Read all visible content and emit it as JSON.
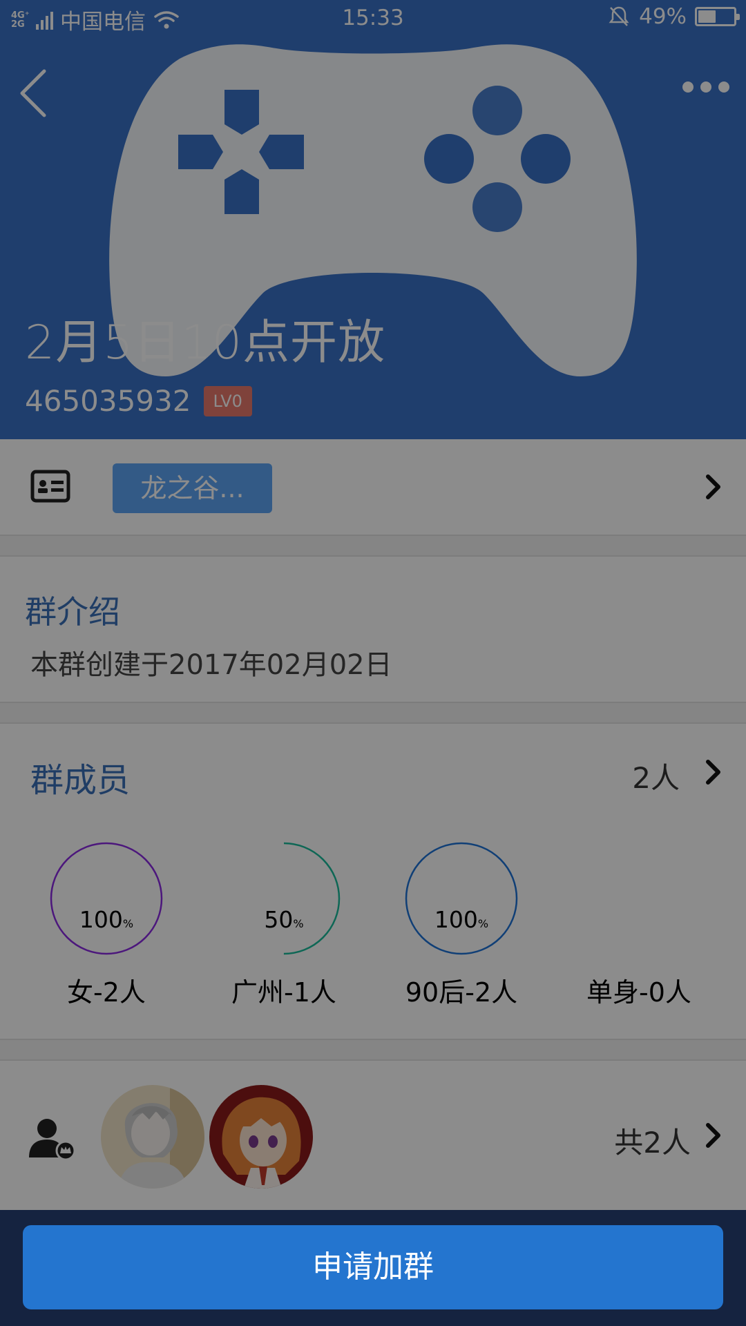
{
  "status_bar": {
    "network": "4G⁺ 2G",
    "carrier": "中国电信",
    "time": "15:33",
    "battery": "49%",
    "battery_level": 0.49
  },
  "header": {
    "bg_color": "#3971c6",
    "icon": "gamepad-icon",
    "title": "2月5日10点开放",
    "group_id": "465035932",
    "level_badge": "LV0"
  },
  "tag_row": {
    "icon": "id-card-icon",
    "tag": "龙之谷..."
  },
  "intro": {
    "title": "群介绍",
    "text": "本群创建于2017年02月02日"
  },
  "members": {
    "title": "群成员",
    "count": "2人",
    "stats": [
      {
        "percent_value": 100,
        "percent": "100",
        "unit": "%",
        "label": "女-2人",
        "color": "#8a2be2"
      },
      {
        "percent_value": 50,
        "percent": "50",
        "unit": "%",
        "label": "广州-1人",
        "color": "#1abc9c"
      },
      {
        "percent_value": 100,
        "percent": "100",
        "unit": "%",
        "label": "90后-2人",
        "color": "#1e73d8"
      },
      {
        "label": "单身-0人"
      }
    ]
  },
  "avatars": {
    "icon": "group-admin-icon",
    "total": "共2人"
  },
  "join_button": "申请加群"
}
